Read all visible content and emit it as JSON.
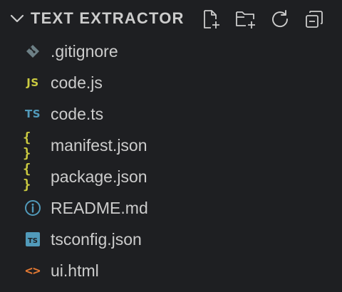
{
  "explorer": {
    "title": "TEXT EXTRACTOR",
    "header_icons": [
      "chevron-down-icon",
      "new-file-icon",
      "new-folder-icon",
      "refresh-icon",
      "collapse-all-icon"
    ],
    "files": [
      {
        "label": ".gitignore",
        "icon": "git-icon"
      },
      {
        "label": "code.js",
        "icon": "javascript-icon",
        "glyph": "JS"
      },
      {
        "label": "code.ts",
        "icon": "typescript-icon",
        "glyph": "TS"
      },
      {
        "label": "manifest.json",
        "icon": "json-icon",
        "glyph": "{ }"
      },
      {
        "label": "package.json",
        "icon": "json-icon",
        "glyph": "{ }"
      },
      {
        "label": "README.md",
        "icon": "info-icon"
      },
      {
        "label": "tsconfig.json",
        "icon": "tsconfig-icon",
        "glyph": "TS"
      },
      {
        "label": "ui.html",
        "icon": "html-icon",
        "glyph": "<>"
      }
    ]
  },
  "colors": {
    "background": "#1e1f22",
    "text": "#cccccc",
    "icon_muted": "#6d8086",
    "javascript": "#cbcb41",
    "typescript": "#519aba",
    "json": "#cbcb41",
    "info": "#519aba",
    "html": "#e37933"
  }
}
